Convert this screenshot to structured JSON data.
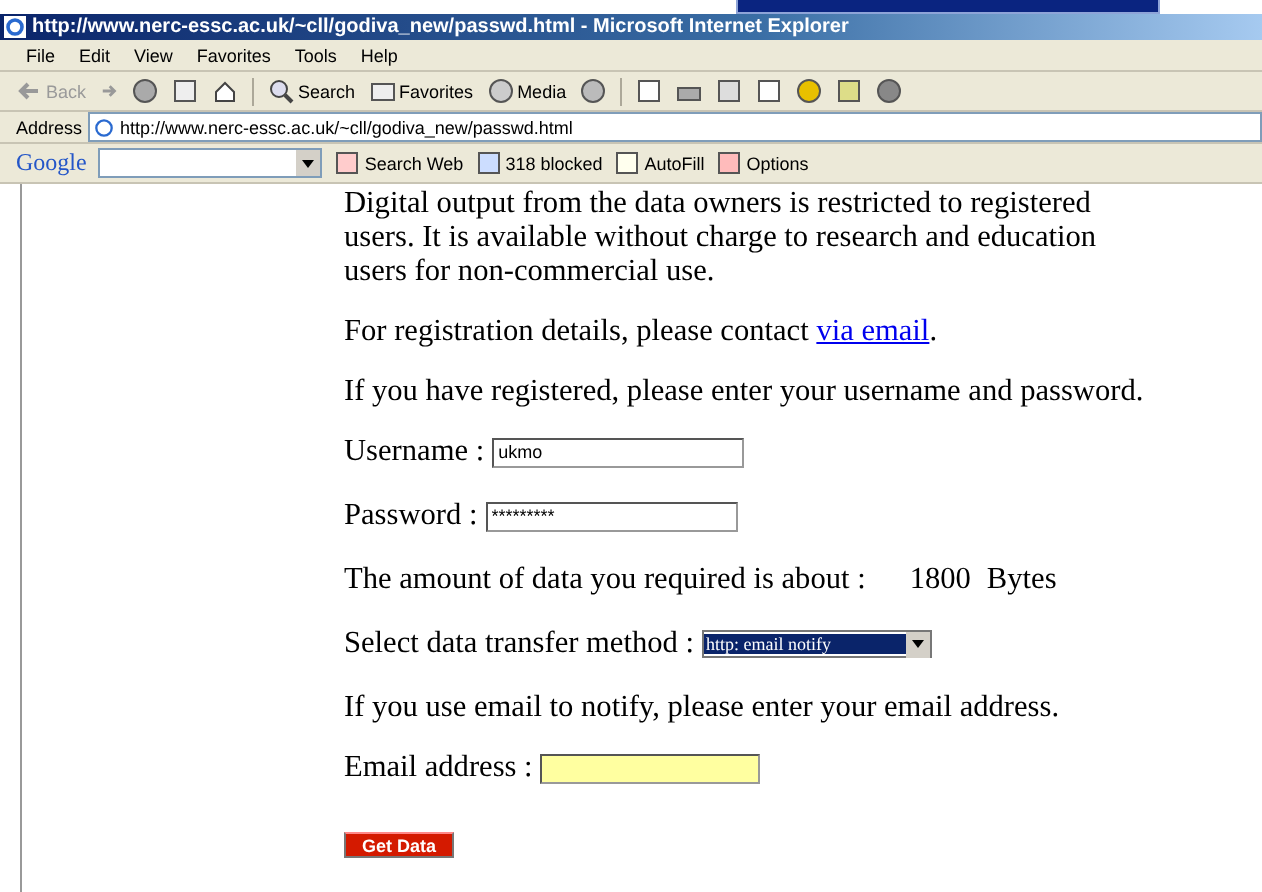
{
  "window": {
    "title": "http://www.nerc-essc.ac.uk/~cll/godiva_new/passwd.html - Microsoft Internet Explorer"
  },
  "menu": [
    "File",
    "Edit",
    "View",
    "Favorites",
    "Tools",
    "Help"
  ],
  "toolbar": [
    {
      "label": "Back",
      "disabled": true
    },
    {
      "label": "Search",
      "disabled": false
    },
    {
      "label": "Favorites",
      "disabled": false
    },
    {
      "label": "Media",
      "disabled": false
    }
  ],
  "address": {
    "label": "Address",
    "url": "http://www.nerc-essc.ac.uk/~cll/godiva_new/passwd.html"
  },
  "google_toolbar": {
    "logo": "Google",
    "items": [
      "Search Web",
      "318 blocked",
      "AutoFill",
      "Options"
    ]
  },
  "page": {
    "paragraphs": [
      {
        "text": "Digital output from the data owners is restricted to registered users. It is available without charge to research and education users for non-commercial use."
      },
      {
        "text": "For registration details, please contact ",
        "link": "via email",
        "after": "."
      },
      {
        "text": "If you have registered, please enter your username and password."
      }
    ],
    "username": {
      "label": "Username :",
      "value": "ukmo"
    },
    "password": {
      "label": "Password :",
      "value": "*********"
    },
    "amount": {
      "label": "The amount of data you required is about :",
      "value": "1800",
      "unit": "Bytes"
    },
    "method": {
      "label": "Select data transfer method :",
      "value": "http: email notify",
      "selected": true
    },
    "email_note": "If you use email to notify, please enter your email address.",
    "email": {
      "label": "Email address :"
    },
    "submit": "Get Data"
  }
}
